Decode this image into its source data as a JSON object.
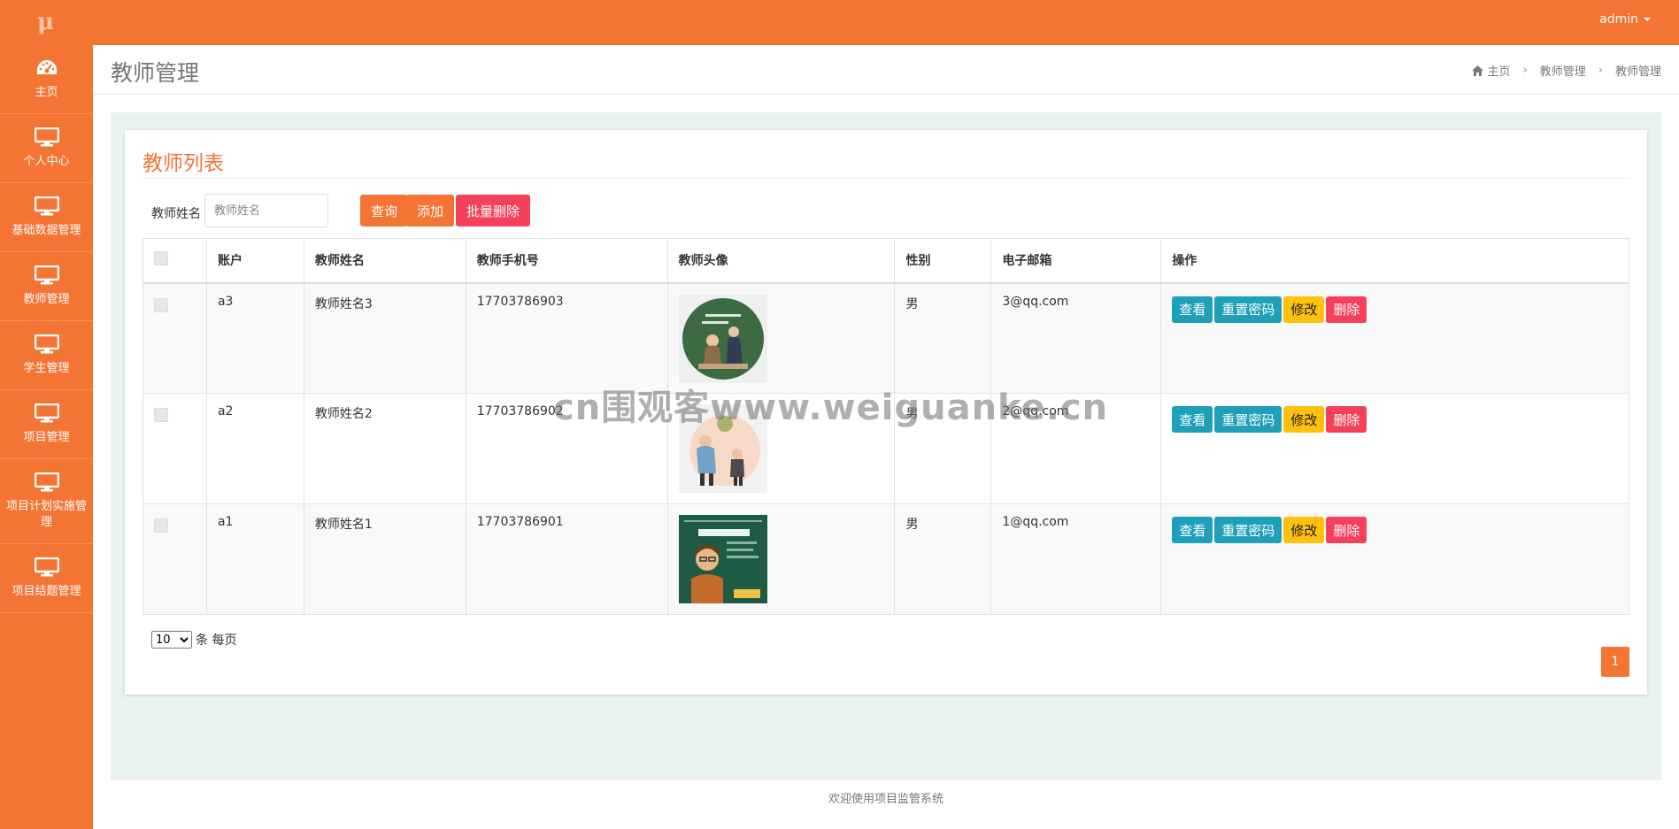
{
  "header": {
    "logo": "μ",
    "user": "admin"
  },
  "sidebar": {
    "items": [
      {
        "label": "主页",
        "icon": "dashboard-icon"
      },
      {
        "label": "个人中心",
        "icon": "monitor-icon"
      },
      {
        "label": "基础数据管理",
        "icon": "monitor-icon"
      },
      {
        "label": "教师管理",
        "icon": "monitor-icon"
      },
      {
        "label": "学生管理",
        "icon": "monitor-icon"
      },
      {
        "label": "项目管理",
        "icon": "monitor-icon"
      },
      {
        "label": "项目计划实施管理",
        "icon": "monitor-icon"
      },
      {
        "label": "项目结题管理",
        "icon": "monitor-icon"
      }
    ]
  },
  "page": {
    "title": "教师管理",
    "breadcrumb": [
      "主页",
      "教师管理",
      "教师管理"
    ]
  },
  "card": {
    "title": "教师列表",
    "search_label": "教师姓名",
    "search_placeholder": "教师姓名",
    "query_label": "查询",
    "add_label": "添加",
    "batch_delete_label": "批量删除"
  },
  "table": {
    "headers": [
      "账户",
      "教师姓名",
      "教师手机号",
      "教师头像",
      "性别",
      "电子邮箱",
      "操作"
    ],
    "rows": [
      {
        "account": "a3",
        "name": "教师姓名3",
        "phone": "17703786903",
        "gender": "男",
        "email": "3@qq.com"
      },
      {
        "account": "a2",
        "name": "教师姓名2",
        "phone": "17703786902",
        "gender": "男",
        "email": "2@qq.com"
      },
      {
        "account": "a1",
        "name": "教师姓名1",
        "phone": "17703786901",
        "gender": "男",
        "email": "1@qq.com"
      }
    ],
    "actions": {
      "view": "查看",
      "reset": "重置密码",
      "edit": "修改",
      "delete": "删除"
    }
  },
  "pager": {
    "size": "10",
    "size_suffix": "条 每页",
    "current": "1"
  },
  "footer": "欢迎使用项目监管系统",
  "watermark": "cn围观客www.weiguanke.cn",
  "colors": {
    "accent": "#f47433",
    "info": "#1ea1b8",
    "warning": "#ffc10e",
    "danger": "#f5405a"
  }
}
